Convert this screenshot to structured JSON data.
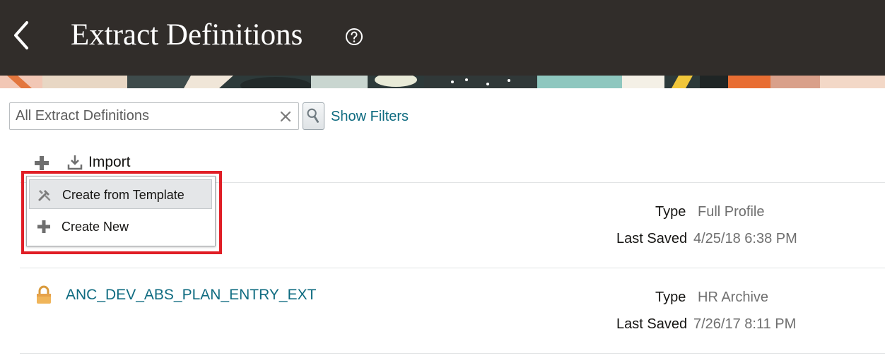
{
  "header": {
    "title": "Extract Definitions",
    "back_icon": "chevron-left-icon",
    "help_icon": "help-circle-icon",
    "background": "#312d2a"
  },
  "search": {
    "placeholder": "All Extract Definitions",
    "value": "",
    "show_filters_label": "Show Filters",
    "link_color": "#0e6b80"
  },
  "toolbar": {
    "add_icon": "plus-icon",
    "import_label": "Import"
  },
  "menu": {
    "items": [
      {
        "label": "Create from Template",
        "icon": "tools-icon",
        "selected": true
      },
      {
        "label": "Create New",
        "icon": "plus-icon",
        "selected": false
      }
    ],
    "highlight_color": "#e01e26"
  },
  "rows": [
    {
      "name": "",
      "type_label": "Type",
      "type": "Full Profile",
      "saved_label": "Last Saved",
      "saved": "4/25/18 6:38 PM"
    },
    {
      "name": "ANC_DEV_ABS_PLAN_ENTRY_EXT",
      "icon": "lock-icon",
      "type_label": "Type",
      "type": "HR Archive",
      "saved_label": "Last Saved",
      "saved": "7/26/17 8:11 PM"
    }
  ]
}
